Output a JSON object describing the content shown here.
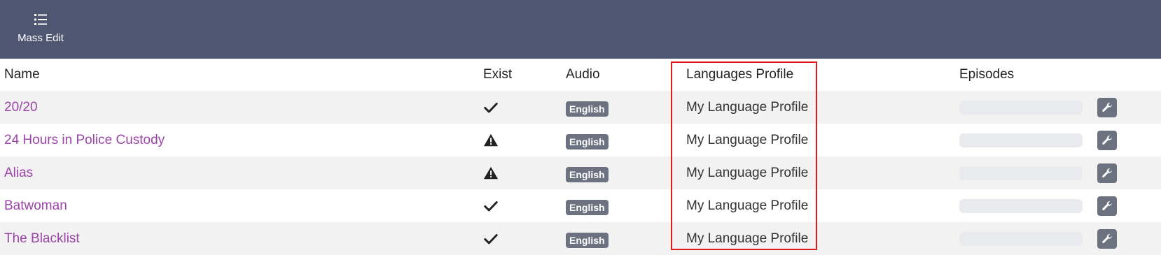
{
  "toolbar": {
    "mass_edit_label": "Mass Edit"
  },
  "table": {
    "headers": {
      "name": "Name",
      "exist": "Exist",
      "audio": "Audio",
      "languages_profile": "Languages Profile",
      "episodes": "Episodes"
    },
    "rows": [
      {
        "name": "20/20",
        "exist_icon": "check-icon",
        "audio": "English",
        "languages_profile": "My Language Profile",
        "episodes_progress": 0
      },
      {
        "name": "24 Hours in Police Custody",
        "exist_icon": "warning-icon",
        "audio": "English",
        "languages_profile": "My Language Profile",
        "episodes_progress": 0
      },
      {
        "name": "Alias",
        "exist_icon": "warning-icon",
        "audio": "English",
        "languages_profile": "My Language Profile",
        "episodes_progress": 0
      },
      {
        "name": "Batwoman",
        "exist_icon": "check-icon",
        "audio": "English",
        "languages_profile": "My Language Profile",
        "episodes_progress": 0
      },
      {
        "name": "The Blacklist",
        "exist_icon": "check-icon",
        "audio": "English",
        "languages_profile": "My Language Profile",
        "episodes_progress": 0
      }
    ]
  },
  "colors": {
    "toolbar_bg": "#4f5672",
    "link": "#9b45a8",
    "badge_bg": "#6c7280",
    "highlight": "#e0191b",
    "row_alt": "#f2f2f2"
  }
}
